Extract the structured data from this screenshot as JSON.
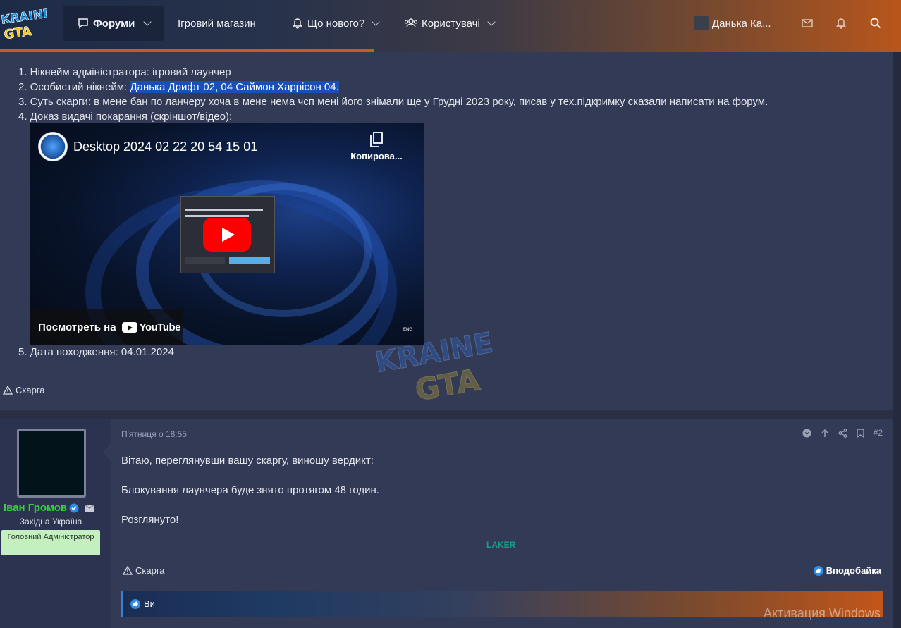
{
  "header": {
    "logo_alt": "UKRAINE GTA",
    "nav": {
      "forums": "Форуми",
      "shop": "Ігровий магазин",
      "whats_new": "Що нового?",
      "users": "Користувачі"
    },
    "user_name": "Данька Ка...",
    "accent_color": "#c95b22"
  },
  "post1": {
    "items": {
      "i1": "1. Нікнейм адміністратора: ігровий лаунчер",
      "i2_prefix": "2. Особистий нікнейм: ",
      "i2_highlight": "Данька Дрифт 02, 04 Саймон Харрісон 04.",
      "i3": "3. Суть скарги: в мене бан по ланчеру хоча в мене нема чсп мені його знімали ще у Грудні 2023 року, писав у тех.підкримку сказали написати на форум.",
      "i4": "4. Доказ видачі покарання (скріншот/відео):",
      "i5": "5. Дата походження: 04.01.2024"
    },
    "video": {
      "title": "Desktop 2024 02 22 20 54 15 01",
      "copy": "Копирова...",
      "watch_on": "Посмотреть на",
      "youtube": "YouTube",
      "lang": "ENG"
    },
    "report": "Скарга"
  },
  "post2": {
    "author": {
      "name": "Іван Громов",
      "region": "Західна Україна",
      "role": "Головний Адміністратор"
    },
    "date": "П'ятниця о 18:55",
    "number": "#2",
    "paragraphs": {
      "p1": "Вітаю, переглянувши вашу скаргу, виношу вердикт:",
      "p2": "Блокування лаунчера буде знято протягом 48 годин.",
      "p3": "Розглянуто!"
    },
    "signature": "LAKER",
    "report": "Скарга",
    "like": "Вподобайка",
    "likes_text": "Ви"
  },
  "os": {
    "activate": "Активация Windows"
  }
}
